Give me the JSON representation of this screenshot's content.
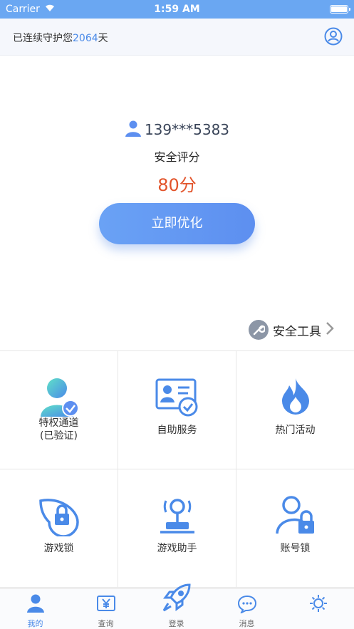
{
  "status": {
    "carrier": "Carrier",
    "time": "1:59 AM"
  },
  "guard": {
    "prefix": "已连续守护您",
    "days": "2064",
    "suffix": "天"
  },
  "account": {
    "phone": "139***5383",
    "score_label": "安全评分",
    "score": "80分",
    "optimize_label": "立即优化"
  },
  "tools": {
    "label": "安全工具"
  },
  "grid": [
    {
      "label": "特权通道\n(已验证)",
      "icon": "privilege-user-check-icon"
    },
    {
      "label": "自助服务",
      "icon": "id-card-check-icon"
    },
    {
      "label": "热门活动",
      "icon": "flame-icon"
    },
    {
      "label": "游戏锁",
      "icon": "leaf-lock-icon"
    },
    {
      "label": "游戏助手",
      "icon": "joystick-icon"
    },
    {
      "label": "账号锁",
      "icon": "user-lock-icon"
    }
  ],
  "tabs": [
    {
      "label": "我的",
      "icon": "user-icon"
    },
    {
      "label": "查询",
      "icon": "yuan-query-icon"
    },
    {
      "label": "登录",
      "icon": "rocket-icon"
    },
    {
      "label": "消息",
      "icon": "chat-icon"
    },
    {
      "label": "",
      "icon": "more-icon"
    }
  ],
  "colors": {
    "accent": "#5d8ff0",
    "score": "#e2542b",
    "status_bar": "#6aa7f2"
  }
}
